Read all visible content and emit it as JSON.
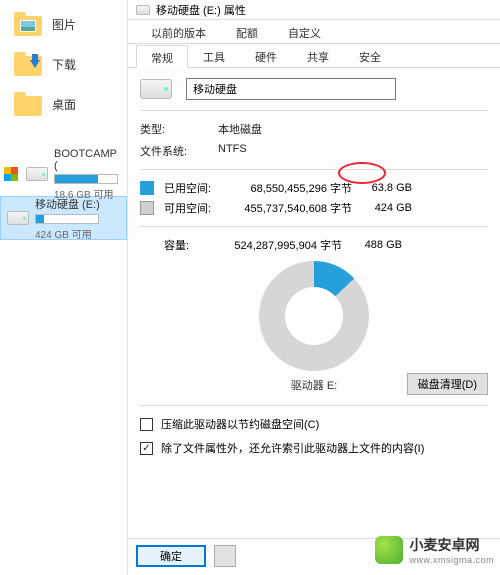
{
  "sidebar": {
    "folders": [
      {
        "label": "图片",
        "kind": "pictures"
      },
      {
        "label": "下载",
        "kind": "downloads"
      },
      {
        "label": "桌面",
        "kind": "desktop"
      }
    ],
    "drives": [
      {
        "name": "BOOTCAMP (",
        "sub": "18.6 GB 可用",
        "fill_pct": 70,
        "win": true,
        "selected": false
      },
      {
        "name": "移动硬盘 (E:)",
        "sub": "424 GB 可用",
        "fill_pct": 13,
        "win": false,
        "selected": true
      }
    ]
  },
  "dialog": {
    "title": "移动硬盘 (E:) 属性",
    "upper_tabs": [
      "以前的版本",
      "配额",
      "自定义"
    ],
    "lower_tabs": [
      "常规",
      "工具",
      "硬件",
      "共享",
      "安全"
    ],
    "active_tab": "常规",
    "name_value": "移动硬盘",
    "type_label": "类型:",
    "type_value": "本地磁盘",
    "fs_label": "文件系统:",
    "fs_value": "NTFS",
    "used_label": "已用空间:",
    "used_bytes": "68,550,455,296 字节",
    "used_short": "63.8 GB",
    "free_label": "可用空间:",
    "free_bytes": "455,737,540,608 字节",
    "free_short": "424 GB",
    "capacity_label": "容量:",
    "capacity_bytes": "524,287,995,904 字节",
    "capacity_short": "488 GB",
    "drive_letter": "驱动器 E:",
    "cleanup_btn": "磁盘清理(D)",
    "compress_label": "压缩此驱动器以节约磁盘空间(C)",
    "index_label": "除了文件属性外，还允许索引此驱动器上文件的内容(I)",
    "index_checked": true,
    "ok_btn": "确定"
  },
  "watermark": {
    "title": "小麦安卓网",
    "sub": "www.xmsigma.com"
  },
  "chart_data": {
    "type": "pie",
    "title": "驱动器 E:",
    "series": [
      {
        "name": "已用空间",
        "value": 68550455296,
        "color": "#26a0da"
      },
      {
        "name": "可用空间",
        "value": 455737540608,
        "color": "#d6d6d6"
      }
    ]
  }
}
